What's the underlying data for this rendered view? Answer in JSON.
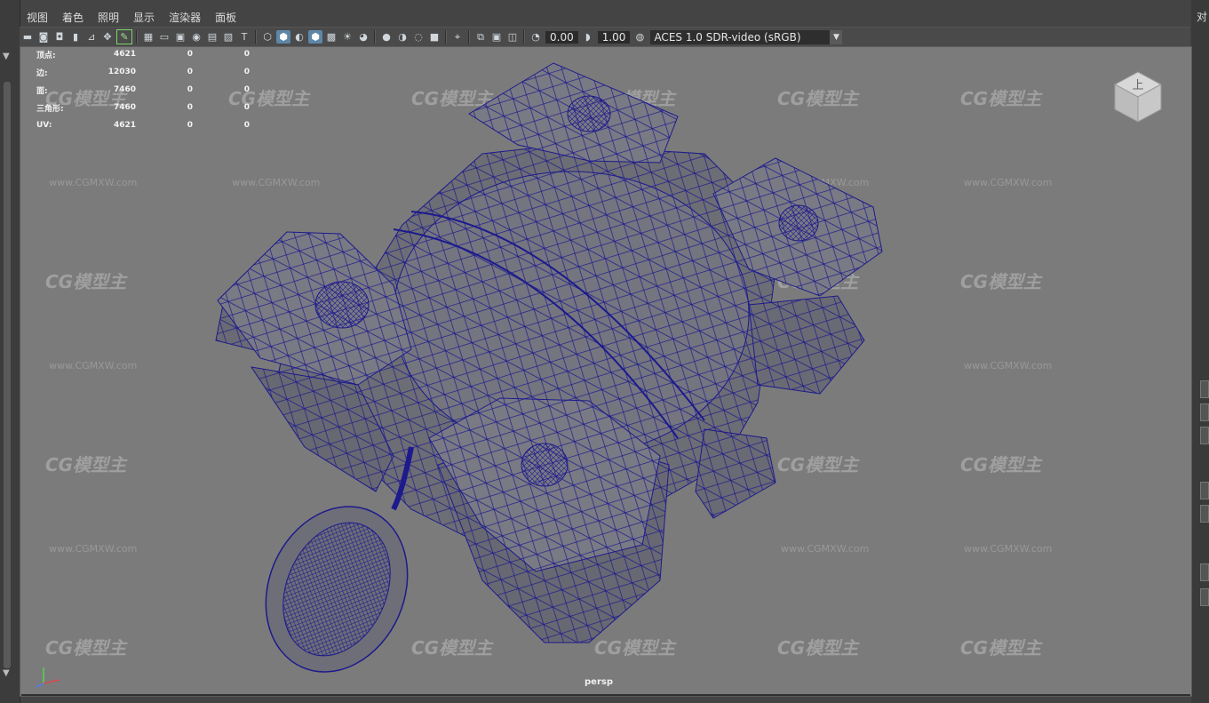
{
  "menu": [
    "视图",
    "着色",
    "照明",
    "显示",
    "渲染器",
    "面板"
  ],
  "toolbar": {
    "exposure": "0.00",
    "gamma": "1.00",
    "color_space": "ACES 1.0 SDR-video (sRGB)",
    "icons": [
      "camera-icon",
      "camera-attr-icon",
      "bookmark-icon",
      "image-plane-icon",
      "grease-pencil-icon",
      "grid-icon",
      "film-gate-icon",
      "resolution-gate-icon",
      "safe-title-icon",
      "field-chart-icon",
      "text-icon",
      "wireframe-icon",
      "smooth-shade-icon",
      "default-material-icon",
      "wireframe-on-shaded-icon",
      "xray-icon",
      "light-icon",
      "shadow-icon",
      "ambient-occlusion-icon",
      "motion-blur-icon",
      "antialias-icon",
      "depth-icon",
      "isolate-icon",
      "xray-joints-icon",
      "exposure-icon",
      "gamma-icon",
      "colorspace-icon"
    ]
  },
  "hud": {
    "rows": [
      {
        "label": "顶点:",
        "v1": "4621",
        "v2": "0",
        "v3": "0"
      },
      {
        "label": "边:",
        "v1": "12030",
        "v2": "0",
        "v3": "0"
      },
      {
        "label": "面:",
        "v1": "7460",
        "v2": "0",
        "v3": "0"
      },
      {
        "label": "三角形:",
        "v1": "7460",
        "v2": "0",
        "v3": "0"
      },
      {
        "label": "UV:",
        "v1": "4621",
        "v2": "0",
        "v3": "0"
      }
    ]
  },
  "viewport": {
    "camera": "persp",
    "viewcube_face": "上",
    "watermark_text": "CG模型主",
    "watermark_url": "www.CGMXW.com",
    "wire_color": "#1c1a8c",
    "mesh_color": "#6e6e78"
  },
  "right_panel": {
    "label": "对"
  }
}
